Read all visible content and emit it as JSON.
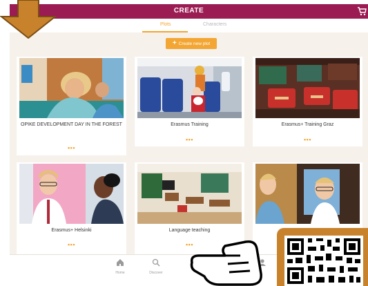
{
  "header": {
    "title": "CREATE",
    "cart_icon": "cart-icon"
  },
  "tabs": [
    {
      "label": "Plots",
      "active": true
    },
    {
      "label": "Characters",
      "active": false
    }
  ],
  "create_button": {
    "label": "Create new plot",
    "icon": "plus-icon"
  },
  "cards": [
    {
      "title": "OPIKE DEVELOPMENT DAY IN THE FOREST",
      "menu": "•••"
    },
    {
      "title": "Erasmus Training",
      "menu": "•••"
    },
    {
      "title": "Erasmus+ Training Graz",
      "menu": "•••"
    },
    {
      "title": "Erasmus+ Helsinki",
      "menu": "•••"
    },
    {
      "title": "Language teaching",
      "menu": "•••"
    },
    {
      "title": "",
      "menu": ""
    }
  ],
  "bottom_nav": [
    {
      "label": "Home",
      "icon": "home-icon"
    },
    {
      "label": "Discover",
      "icon": "search-icon"
    },
    {
      "label": "",
      "icon": "create-icon"
    },
    {
      "label": "",
      "icon": "chat-icon"
    },
    {
      "label": "",
      "icon": "profile-icon"
    }
  ],
  "colors": {
    "header": "#9b1b53",
    "accent": "#f3a633",
    "background": "#f6f1ea",
    "overlay": "#c8822b"
  }
}
